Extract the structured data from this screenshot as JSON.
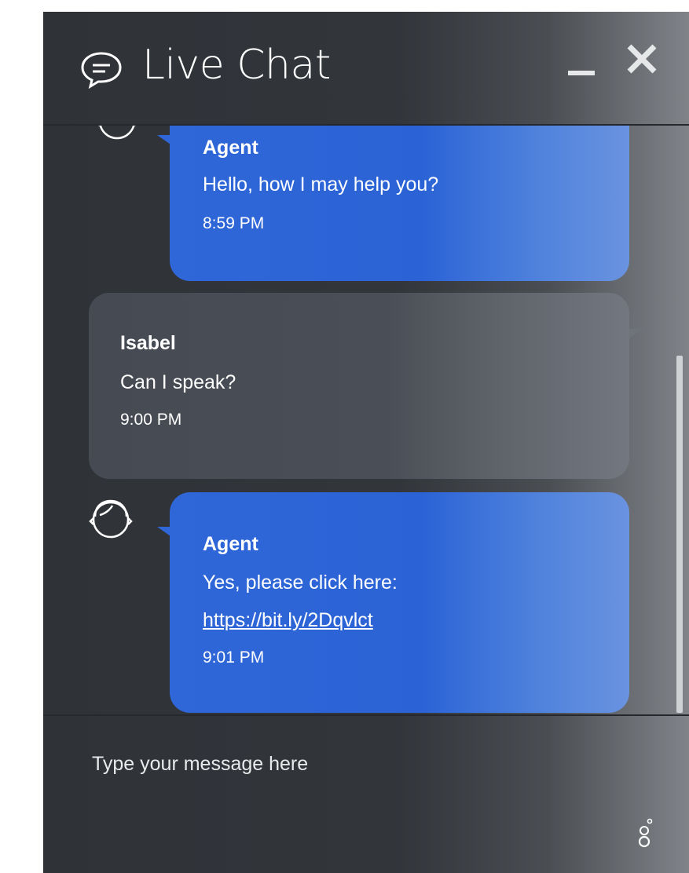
{
  "header": {
    "title": "Live Chat",
    "icons": {
      "chat": "chat-bubble-icon",
      "minimize": "minimize-icon",
      "close": "close-icon"
    }
  },
  "messages": [
    {
      "sender": "Agent",
      "text": "Hello, how I may help you?",
      "time": "8:59 PM",
      "role": "agent"
    },
    {
      "sender": "Isabel",
      "text": "Can I speak?",
      "time": "9:00 PM",
      "role": "user"
    },
    {
      "sender": "Agent",
      "text": "Yes, please click here:",
      "link": "https://bit.ly/2Dqvlct",
      "time": "9:01 PM",
      "role": "agent"
    }
  ],
  "composer": {
    "placeholder": "Type your message here",
    "value": ""
  },
  "colors": {
    "agent_bubble": "#2f67d8",
    "user_bubble": "#4a4e56",
    "panel": "#32363b"
  }
}
